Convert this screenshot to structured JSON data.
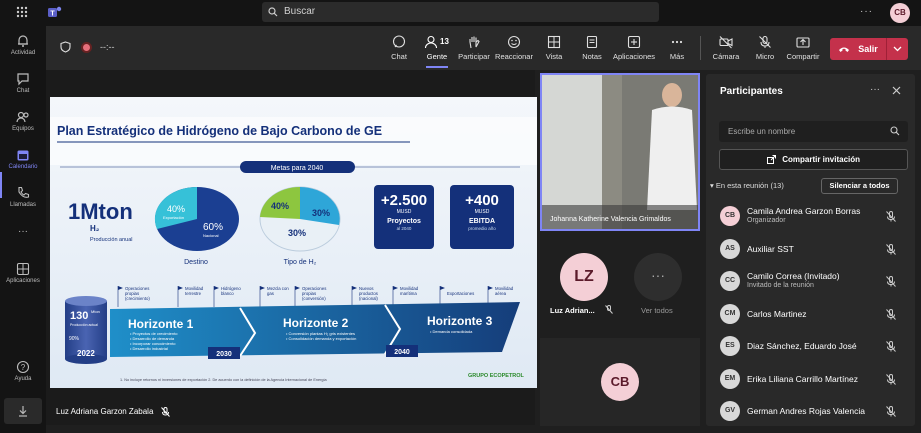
{
  "topbar": {
    "search_placeholder": "Buscar",
    "avatar_initials": "CB",
    "more_dots": "···"
  },
  "rail": [
    {
      "label": "Actividad",
      "icon": "bell-icon"
    },
    {
      "label": "Chat",
      "icon": "chat-icon"
    },
    {
      "label": "Equipos",
      "icon": "teams-icon"
    },
    {
      "label": "Calendario",
      "icon": "calendar-icon",
      "active": true
    },
    {
      "label": "Llamadas",
      "icon": "phone-icon"
    },
    {
      "label": "···",
      "icon": "more-icon"
    },
    {
      "label": "Aplicaciones",
      "icon": "apps-icon"
    },
    {
      "label": "Ayuda",
      "icon": "help-icon"
    }
  ],
  "toolbar": {
    "timer": "--:--",
    "chat": "Chat",
    "people": "Gente",
    "people_count": "13",
    "raise": "Participar",
    "react": "Reaccionar",
    "view": "Vista",
    "notes": "Notas",
    "apps": "Aplicaciones",
    "more": "Más",
    "camera": "Cámara",
    "mic": "Micro",
    "share": "Compartir",
    "leave": "Salir"
  },
  "slide": {
    "title": "Plan Estratégico de Hidrógeno de Bajo Carbono de GE",
    "goals": "Metas para 2040",
    "prod_big": "1Mton",
    "prod_h2": "H₂",
    "prod_label": "Producción anual",
    "pie1_a": "40%",
    "pie1_a_label": "Exportación",
    "pie1_b": "60%",
    "pie1_b_label": "Nacional",
    "pie1_caption": "Destino",
    "pie2_a": "40%",
    "pie2_b": "30%",
    "pie2_c": "30%",
    "pie2_caption": "Tipo de H₂",
    "box1_value": "+2.500",
    "box1_unit": "MUSD",
    "box1_label": "Proyectos",
    "box1_sub": "al 2040",
    "box2_value": "+400",
    "box2_unit": "MUSD",
    "box2_label": "EBITDA",
    "box2_sub": "promedio año",
    "stack_value": "130",
    "stack_unit": "Mton",
    "stack_sub": "Producción actual",
    "stack_pct": "90%",
    "stack_year": "2022",
    "flags": [
      "Operaciones propias (crecimiento)",
      "Movilidad terrestre",
      "Hidrógeno blanco",
      "Mezcla con gas",
      "Operaciones propias (conversión)",
      "Nuevos productos (nacional)",
      "Movilidad marítima",
      "Exportaciones",
      "Movilidad aérea"
    ],
    "h1": "Horizonte 1",
    "h1_items": [
      "Proyectos de crecimiento",
      "Desarrollo de demanda",
      "Incorporar conocimiento",
      "Desarrollo industrial"
    ],
    "h1_year": "2030",
    "h2": "Horizonte 2",
    "h2_items": [
      "Conversión plantas H₂ gris existentes",
      "Consolidación demanda y exportación"
    ],
    "h2_year": "2040",
    "h3": "Horizonte 3",
    "h3_items": [
      "Demanda consolidada"
    ],
    "footnote": "1. No incluye retornos ni inversiones de exportación   2. De acuerdo con la definición de la Agencia Internacional de Energía",
    "logo": "GRUPO ECOPETROL"
  },
  "presenter_label": "Luz Adriana Garzon Zabala",
  "video": {
    "name": "Johanna Katherine Valencia Grimaldos"
  },
  "tiles": {
    "lz_initials": "LZ",
    "lz_name": "Luz Adrian...",
    "more_label": "Ver todos",
    "more_dots": "···",
    "cb_initials": "CB"
  },
  "panel": {
    "title": "Participantes",
    "search_placeholder": "Escribe un nombre",
    "share": "Compartir invitación",
    "section": "En esta reunión (13)",
    "mute_all": "Silenciar a todos",
    "participants": [
      {
        "initials": "CB",
        "name": "Camila Andrea Garzon Borras",
        "role": "Organizador",
        "color": "#f4cfd6"
      },
      {
        "initials": "AS",
        "name": "Auxiliar SST",
        "role": "",
        "color": "#d8d8d8"
      },
      {
        "initials": "CC",
        "name": "Camilo Correa (Invitado)",
        "role": "Invitado de la reunión",
        "color": "#d8d8d8"
      },
      {
        "initials": "CM",
        "name": "Carlos Martinez",
        "role": "",
        "color": "#d8d8d8"
      },
      {
        "initials": "ES",
        "name": "Diaz Sánchez, Eduardo José",
        "role": "",
        "color": "#d8d8d8"
      },
      {
        "initials": "EM",
        "name": "Erika Liliana Carrillo Martínez",
        "role": "",
        "color": "#d8d8d8"
      },
      {
        "initials": "GV",
        "name": "German Andres Rojas Valencia",
        "role": "",
        "color": "#d8d8d8"
      }
    ]
  }
}
